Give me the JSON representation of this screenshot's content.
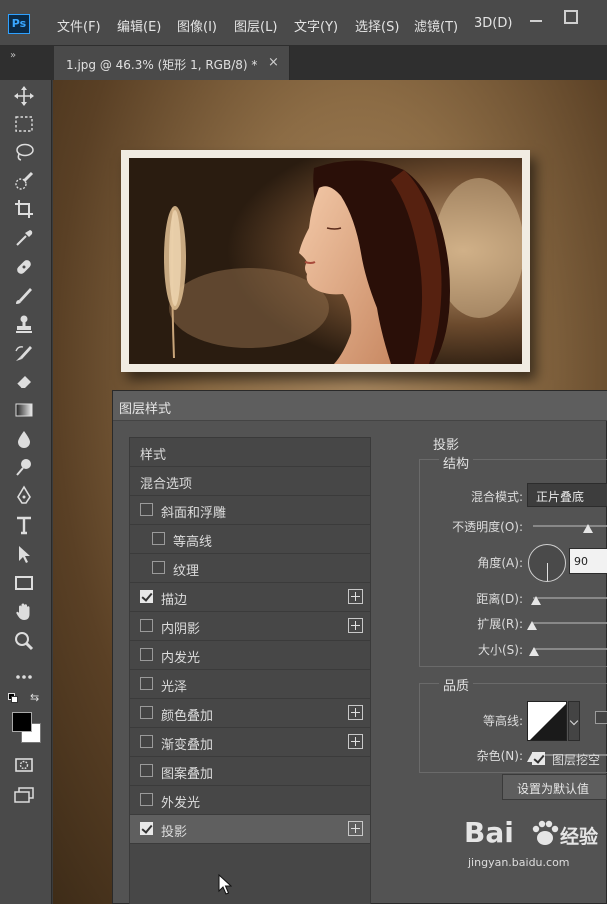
{
  "menu": {
    "logo": "Ps",
    "items": [
      "文件(F)",
      "编辑(E)",
      "图像(I)",
      "图层(L)",
      "文字(Y)",
      "选择(S)",
      "滤镜(T)",
      "3D(D)"
    ]
  },
  "tabbar": {
    "panel_toggle": "»",
    "doc_title": "1.jpg @ 46.3% (矩形 1, RGB/8) *",
    "close": "×"
  },
  "toolbar": {
    "tools": [
      "move-tool",
      "marquee-tool",
      "lasso-tool",
      "quick-select-tool",
      "crop-tool",
      "eyedropper-tool",
      "healing-brush-tool",
      "brush-tool",
      "clone-stamp-tool",
      "history-brush-tool",
      "eraser-tool",
      "gradient-tool",
      "blur-tool",
      "dodge-tool",
      "pen-tool",
      "type-tool",
      "path-select-tool",
      "rectangle-tool",
      "hand-tool",
      "zoom-tool",
      "more-tools",
      "swap-colors",
      "foreground-background-colors",
      "quick-mask",
      "screen-mode"
    ],
    "foreground_color": "#000000",
    "background_color": "#ffffff"
  },
  "dialog": {
    "title": "图层样式",
    "style_list": [
      {
        "label": "样式",
        "checkbox": false,
        "checked": false,
        "plus": false,
        "indent": 0
      },
      {
        "label": "混合选项",
        "checkbox": false,
        "checked": false,
        "plus": false,
        "indent": 0
      },
      {
        "label": "斜面和浮雕",
        "checkbox": true,
        "checked": false,
        "plus": false,
        "indent": 0
      },
      {
        "label": "等高线",
        "checkbox": true,
        "checked": false,
        "plus": false,
        "indent": 1
      },
      {
        "label": "纹理",
        "checkbox": true,
        "checked": false,
        "plus": false,
        "indent": 1
      },
      {
        "label": "描边",
        "checkbox": true,
        "checked": true,
        "plus": true,
        "indent": 0
      },
      {
        "label": "内阴影",
        "checkbox": true,
        "checked": false,
        "plus": true,
        "indent": 0
      },
      {
        "label": "内发光",
        "checkbox": true,
        "checked": false,
        "plus": false,
        "indent": 0
      },
      {
        "label": "光泽",
        "checkbox": true,
        "checked": false,
        "plus": false,
        "indent": 0
      },
      {
        "label": "颜色叠加",
        "checkbox": true,
        "checked": false,
        "plus": true,
        "indent": 0
      },
      {
        "label": "渐变叠加",
        "checkbox": true,
        "checked": false,
        "plus": true,
        "indent": 0
      },
      {
        "label": "图案叠加",
        "checkbox": true,
        "checked": false,
        "plus": false,
        "indent": 0
      },
      {
        "label": "外发光",
        "checkbox": true,
        "checked": false,
        "plus": false,
        "indent": 0
      },
      {
        "label": "投影",
        "checkbox": true,
        "checked": true,
        "plus": true,
        "indent": 0,
        "selected": true
      }
    ],
    "drop_shadow": {
      "title": "投影",
      "structure": {
        "title": "结构",
        "blend_mode_label": "混合模式:",
        "blend_mode_value": "正片叠底",
        "opacity_label": "不透明度(O):",
        "opacity_level": 0.62,
        "angle_label": "角度(A):",
        "angle_value": "90",
        "distance_label": "距离(D):",
        "distance_level": 0.03,
        "spread_label": "扩展(R):",
        "spread_level": 0.0,
        "size_label": "大小(S):",
        "size_level": 0.02
      },
      "quality": {
        "title": "品质",
        "contour_label": "等高线:",
        "noise_label": "杂色(N):",
        "noise_level": 0.0
      },
      "knockout_label": "图层挖空",
      "knockout_checked": true,
      "default_button": "设置为默认值"
    }
  },
  "watermark": {
    "brand": "Bai",
    "brand_suffix": "经验",
    "url": "jingyan.baidu.com"
  }
}
